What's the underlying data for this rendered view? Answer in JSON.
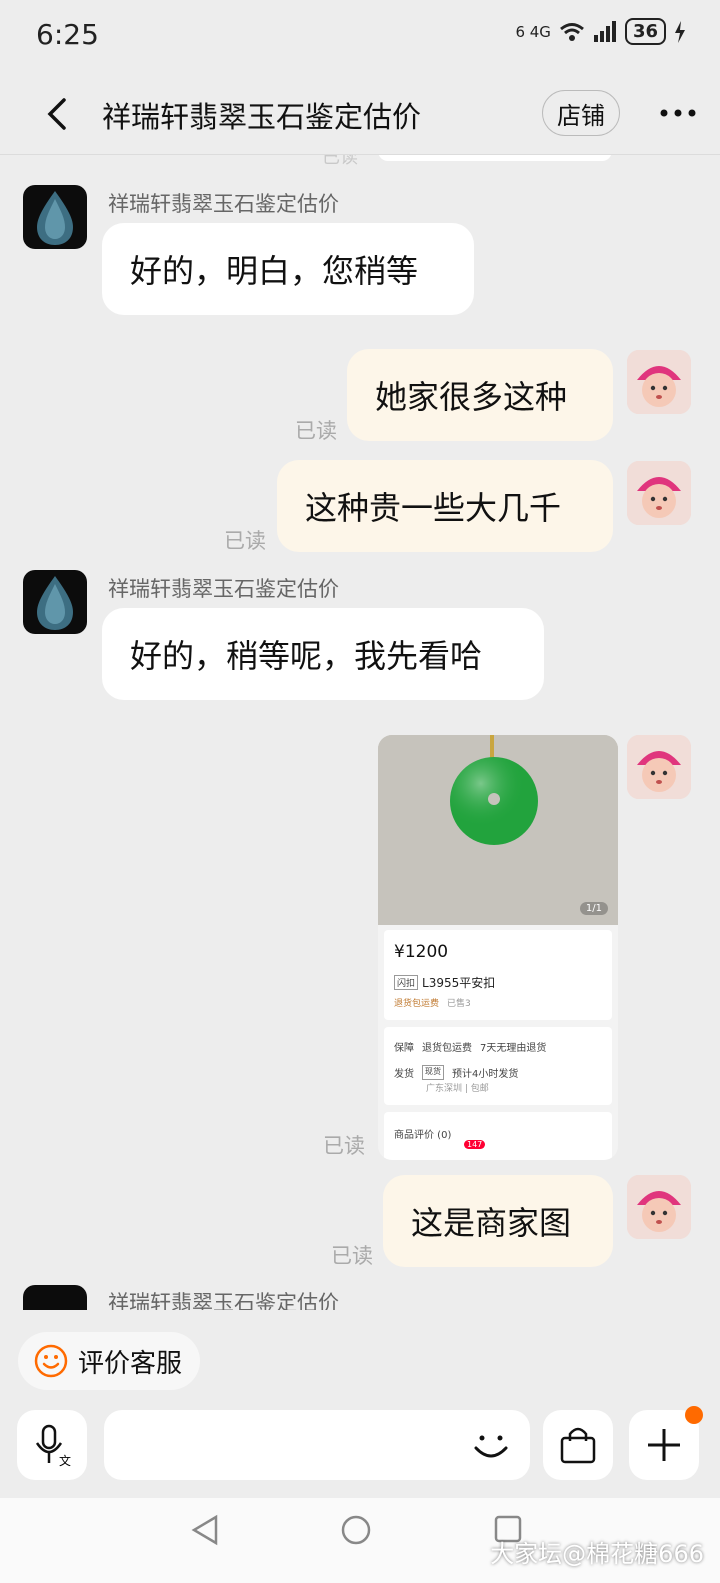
{
  "status_bar": {
    "time": "6:25",
    "network": "6 4G",
    "battery": "36"
  },
  "header": {
    "title": "祥瑞轩翡翠玉石鉴定估价",
    "shop_label": "店铺"
  },
  "chat": {
    "top_partial_read": "已读",
    "messages": [
      {
        "sender": "祥瑞轩翡翠玉石鉴定估价",
        "text": "好的，明白，您稍等"
      },
      {
        "text": "她家很多这种",
        "read": "已读"
      },
      {
        "text": "这种贵一些大几千",
        "read": "已读"
      },
      {
        "sender": "祥瑞轩翡翠玉石鉴定估价",
        "text": "好的，稍等呢，我先看哈"
      },
      {
        "text": "这是商家图",
        "read": "已读"
      }
    ],
    "product_read": "已读",
    "bottom_partial_sender": "祥瑞轩翡翠玉石鉴定估价"
  },
  "product": {
    "image_counter": "1/1",
    "price": "¥1200",
    "tag": "闪扣",
    "name": "L3955平安扣",
    "shipping_note": "退货包运费",
    "sold": "已售3",
    "guarantee_label": "保障",
    "guarantee_1": "退货包运费",
    "guarantee_2": "7天无理由退货",
    "delivery_label": "发货",
    "delivery_tag": "现货",
    "delivery_text": "预计4小时发货",
    "delivery_location": "广东深圳 | 包邮",
    "reviews": "商品评价 (0)",
    "cart_badge": "147"
  },
  "composer": {
    "rate_label": "评价客服"
  },
  "watermark": "大家坛@棉花糖666",
  "colors": {
    "accent": "#ff6a00",
    "outgoing_bubble": "#fdf6e9",
    "background": "#ededed"
  }
}
